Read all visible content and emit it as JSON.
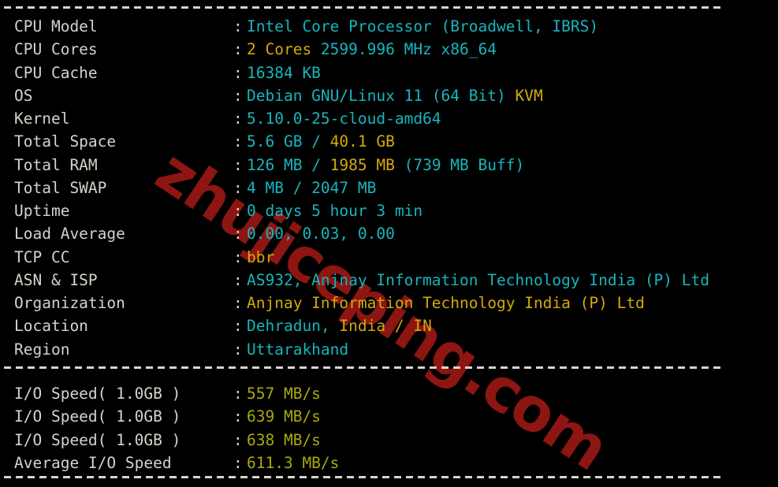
{
  "terminal": {
    "title": "bench.sh system information output",
    "background_color": "#000000",
    "label_color": "#d6d2cb",
    "cyan_color": "#17b5bd",
    "yellow_color": "#d2aa0c",
    "olive_color": "#a8a80d",
    "watermark": {
      "text": "zhujiceping.com",
      "color": "#8d1512"
    },
    "separator_char": "-",
    "colon": ":"
  },
  "system_info": [
    {
      "label": "CPU Model",
      "value": "Intel Core Processor (Broadwell, IBRS)",
      "parts": [
        {
          "text": "Intel Core Processor (Broadwell, IBRS)",
          "color": "cyan"
        }
      ]
    },
    {
      "label": "CPU Cores",
      "value": "2 Cores 2599.996 MHz x86_64",
      "parts": [
        {
          "text": "2 Cores ",
          "color": "yellow"
        },
        {
          "text": "2599.996 MHz x86_64",
          "color": "cyan"
        }
      ]
    },
    {
      "label": "CPU Cache",
      "value": "16384 KB",
      "parts": [
        {
          "text": "16384 KB",
          "color": "cyan"
        }
      ]
    },
    {
      "label": "OS",
      "value": "Debian GNU/Linux 11 (64 Bit) KVM",
      "parts": [
        {
          "text": "Debian GNU/Linux 11 (64 Bit) ",
          "color": "cyan"
        },
        {
          "text": "KVM",
          "color": "yellow"
        }
      ]
    },
    {
      "label": "Kernel",
      "value": "5.10.0-25-cloud-amd64",
      "parts": [
        {
          "text": "5.10.0-25-cloud-amd64",
          "color": "cyan"
        }
      ]
    },
    {
      "label": "Total Space",
      "value": "5.6 GB / 40.1 GB",
      "parts": [
        {
          "text": "5.6 GB ",
          "color": "cyan"
        },
        {
          "text": "/ ",
          "color": "cyan"
        },
        {
          "text": "40.1 GB",
          "color": "yellow"
        }
      ]
    },
    {
      "label": "Total RAM",
      "value": "126 MB / 1985 MB (739 MB Buff)",
      "parts": [
        {
          "text": "126 MB ",
          "color": "cyan"
        },
        {
          "text": "/ ",
          "color": "cyan"
        },
        {
          "text": "1985 MB ",
          "color": "yellow"
        },
        {
          "text": "(739 MB Buff)",
          "color": "cyan"
        }
      ]
    },
    {
      "label": "Total SWAP",
      "value": "4 MB / 2047 MB",
      "parts": [
        {
          "text": "4 MB / 2047 MB",
          "color": "cyan"
        }
      ]
    },
    {
      "label": "Uptime",
      "value": "0 days 5 hour 3 min",
      "parts": [
        {
          "text": "0 days 5 hour 3 min",
          "color": "cyan"
        }
      ]
    },
    {
      "label": "Load Average",
      "value": "0.00, 0.03, 0.00",
      "parts": [
        {
          "text": "0.00, 0.03, 0.00",
          "color": "cyan"
        }
      ]
    },
    {
      "label": "TCP CC",
      "value": "bbr",
      "parts": [
        {
          "text": "bbr",
          "color": "yellow"
        }
      ]
    },
    {
      "label": "ASN & ISP",
      "value": "AS932, Anjnay Information Technology India (P) Ltd",
      "parts": [
        {
          "text": "AS932, Anjnay Information Technology India (P) Ltd",
          "color": "cyan"
        }
      ]
    },
    {
      "label": "Organization",
      "value": "Anjnay Information Technology India (P) Ltd",
      "parts": [
        {
          "text": "Anjnay Information Technology India (P) Ltd",
          "color": "yellow"
        }
      ]
    },
    {
      "label": "Location",
      "value": "Dehradun, India / IN",
      "parts": [
        {
          "text": "Dehradun, ",
          "color": "cyan"
        },
        {
          "text": "India / IN",
          "color": "yellow"
        }
      ]
    },
    {
      "label": "Region",
      "value": "Uttarakhand",
      "parts": [
        {
          "text": "Uttarakhand",
          "color": "cyan"
        }
      ]
    }
  ],
  "io_results": [
    {
      "label": "I/O Speed( 1.0GB )",
      "value": "557 MB/s",
      "parts": [
        {
          "text": "557 MB/s",
          "color": "olive"
        }
      ]
    },
    {
      "label": "I/O Speed( 1.0GB )",
      "value": "639 MB/s",
      "parts": [
        {
          "text": "639 MB/s",
          "color": "olive"
        }
      ]
    },
    {
      "label": "I/O Speed( 1.0GB )",
      "value": "638 MB/s",
      "parts": [
        {
          "text": "638 MB/s",
          "color": "olive"
        }
      ]
    },
    {
      "label": "Average I/O Speed",
      "value": "611.3 MB/s",
      "parts": [
        {
          "text": "611.3 MB/s",
          "color": "olive"
        }
      ]
    }
  ]
}
